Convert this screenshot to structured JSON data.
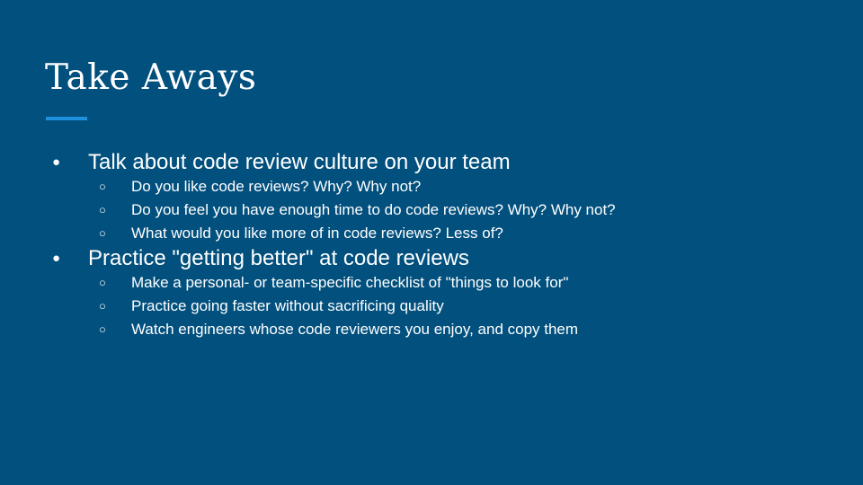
{
  "slide": {
    "title": "Take Aways",
    "accent_color": "#1e90dc",
    "background_color": "#02507e",
    "bullets": [
      {
        "marker": "●",
        "text": "Talk about code review culture on your team",
        "subitems": [
          {
            "marker": "○",
            "text": "Do you like code reviews? Why? Why not?"
          },
          {
            "marker": "○",
            "text": "Do you feel you have enough time to do code reviews? Why? Why not?"
          },
          {
            "marker": "○",
            "text": "What would you like more of in code reviews? Less of?"
          }
        ]
      },
      {
        "marker": "●",
        "text": "Practice \"getting better\" at code reviews",
        "subitems": [
          {
            "marker": "○",
            "text": "Make a personal- or team-specific checklist of \"things to look for\""
          },
          {
            "marker": "○",
            "text": "Practice going faster without sacrificing quality"
          },
          {
            "marker": "○",
            "text": "Watch engineers whose code reviewers you enjoy, and copy them"
          }
        ]
      }
    ]
  }
}
